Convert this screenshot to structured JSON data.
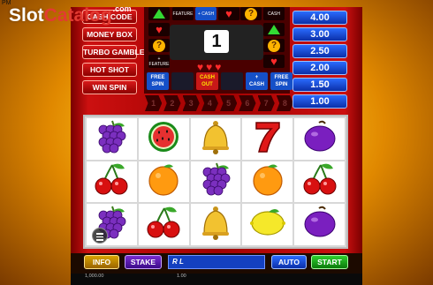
{
  "status_bar": {
    "time": "PM"
  },
  "watermark": {
    "part1": "Slot",
    "part2": "Catalog",
    "suffix": ".com"
  },
  "side_menu": [
    "CASH CODE",
    "MONEY BOX",
    "TURBO GAMBLE",
    "HOT SHOT",
    "WIN SPIN"
  ],
  "ladder": {
    "center_number": "1",
    "feature_cells": [
      {
        "top": "FREE",
        "bottom": "SPIN"
      },
      {
        "top": "",
        "bottom": ""
      },
      {
        "top": "CASH",
        "bottom": "OUT"
      },
      {
        "top": "",
        "bottom": ""
      },
      {
        "top": "+",
        "bottom": "CASH"
      },
      {
        "top": "FREE",
        "bottom": "SPIN"
      }
    ],
    "labels": {
      "feature": "FEATURE",
      "cash": "CASH",
      "plus_feature": "+ FEATURE",
      "plus_cash": "+ CASH"
    },
    "steps": [
      "1",
      "2",
      "3",
      "4",
      "5",
      "6",
      "7",
      "8"
    ]
  },
  "prizes": [
    "4.00",
    "3.00",
    "2.50",
    "2.00",
    "1.50",
    "1.00"
  ],
  "reels": [
    [
      "grapes",
      "watermelon",
      "bell",
      "seven",
      "plum"
    ],
    [
      "cherries",
      "orange",
      "grapes",
      "orange",
      "cherries"
    ],
    [
      "grapes",
      "cherries",
      "bell",
      "lemon",
      "plum"
    ]
  ],
  "controls": {
    "info": "INFO",
    "stake": "STAKE",
    "message": "R L",
    "auto": "AUTO",
    "start": "START"
  },
  "info_strip": {
    "balance": "1,000.00",
    "stake": "1.00"
  },
  "colors": {
    "cabinet_red": "#cc1010",
    "prize_blue": "#1550c8",
    "start_green": "#2fcf2f"
  }
}
